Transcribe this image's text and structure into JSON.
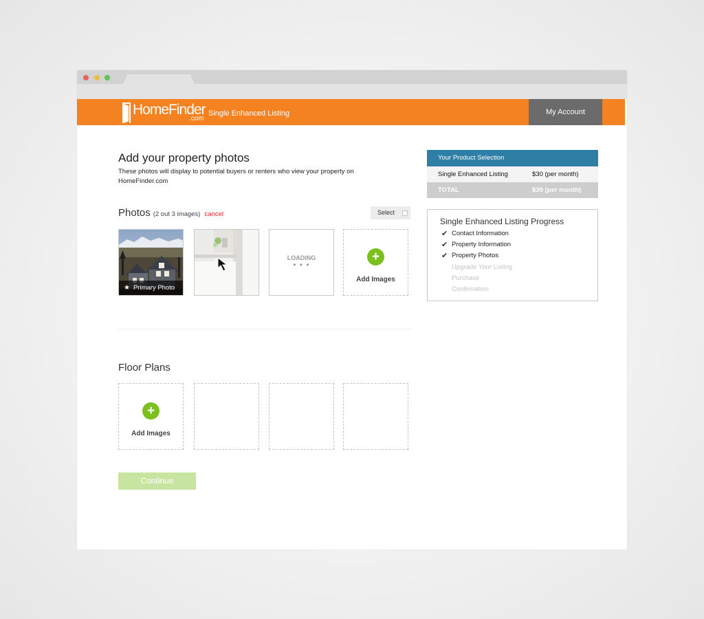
{
  "header": {
    "logo_name": "HomeFinder",
    "logo_suffix": ".com",
    "product_label": "Single Enhanced Listing",
    "account_button": "My Account"
  },
  "page": {
    "title": "Add your property photos",
    "subtitle": "These photos will display to potential buyers or renters who view your property on HomeFinder.com"
  },
  "photos": {
    "heading": "Photos",
    "count": "(2 out 3 images)",
    "cancel": "cancel",
    "select_label": "Select",
    "primary_label": "Primary Photo",
    "loading_label": "LOADING",
    "loading_dots": "• • •",
    "add_label": "Add Images"
  },
  "floor_plans": {
    "heading": "Floor Plans",
    "add_label": "Add Images"
  },
  "continue_label": "Continue",
  "product_selection": {
    "heading": "Your Product Selection",
    "item_name": "Single Enhanced Listing",
    "item_price": "$30 (per month)",
    "total_label": "TOTAL",
    "total_price": "$30 (per month)"
  },
  "progress": {
    "title": "Single Enhanced Listing Progress",
    "steps": [
      {
        "label": "Contact Information",
        "done": true
      },
      {
        "label": "Property Information",
        "done": true
      },
      {
        "label": "Property Photos",
        "done": true
      },
      {
        "label": "Upgrade Your Listing",
        "done": false
      },
      {
        "label": "Purchase",
        "done": false
      },
      {
        "label": "Confirmation",
        "done": false
      }
    ]
  },
  "colors": {
    "brand_orange": "#f58220",
    "selection_blue": "#2f7ea6",
    "add_green": "#7cc01e",
    "cancel_red": "#e0211b",
    "continue_disabled": "#c8e4a1"
  },
  "icons": {
    "add": "plus-circle-icon",
    "check": "checkmark-icon",
    "star": "star-icon",
    "cursor": "arrow-cursor-icon"
  }
}
